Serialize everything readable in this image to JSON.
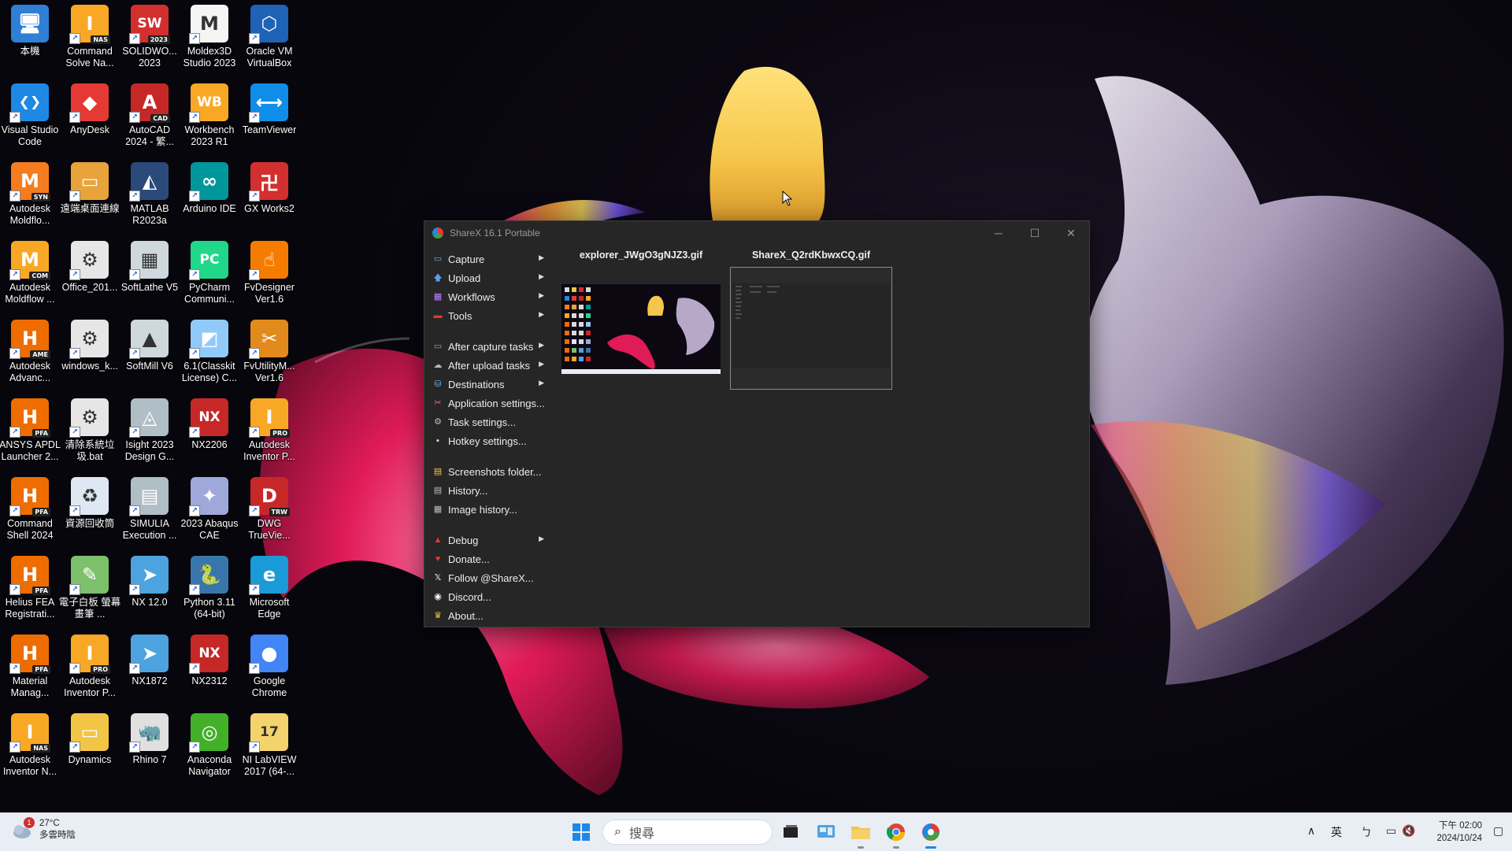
{
  "desktop": {
    "columns": [
      [
        {
          "label": "本機",
          "icon": "computer-icon",
          "color": "#2f7fd6",
          "glyph": "🖥"
        },
        {
          "label": "Visual Studio Code",
          "icon": "vscode-icon",
          "color": "#1e88e5",
          "glyph": "❮❯"
        },
        {
          "label": "Autodesk Moldflo...",
          "icon": "autodesk-moldflow-syn-icon",
          "color": "#f57c1f",
          "glyph": "M",
          "sub": "SYN"
        },
        {
          "label": "Autodesk Moldflow ...",
          "icon": "autodesk-moldflow-com-icon",
          "color": "#f9a825",
          "glyph": "M",
          "sub": "COM"
        },
        {
          "label": "Autodesk Advanc...",
          "icon": "autodesk-advance-icon",
          "color": "#ef6c00",
          "glyph": "H",
          "sub": "AME"
        },
        {
          "label": "ANSYS APDL Launcher 2...",
          "icon": "ansys-apdl-icon",
          "color": "#ef6c00",
          "glyph": "H",
          "sub": "PFA"
        },
        {
          "label": "Command Shell 2024",
          "icon": "command-shell-icon",
          "color": "#ef6c00",
          "glyph": "H",
          "sub": "PFA"
        },
        {
          "label": "Helius FEA Registrati...",
          "icon": "helius-fea-icon",
          "color": "#ef6c00",
          "glyph": "H",
          "sub": "PFA"
        },
        {
          "label": "Material Manag...",
          "icon": "material-manager-icon",
          "color": "#ef6c00",
          "glyph": "H",
          "sub": "PFA"
        },
        {
          "label": "Autodesk Inventor N...",
          "icon": "autodesk-inventor-nas-icon",
          "color": "#f9a825",
          "glyph": "I",
          "sub": "NAS"
        }
      ],
      [
        {
          "label": "Command Solve Na...",
          "icon": "command-solve-nas-icon",
          "color": "#f9a825",
          "glyph": "I",
          "sub": "NAS"
        },
        {
          "label": "AnyDesk",
          "icon": "anydesk-icon",
          "color": "#e53935",
          "glyph": "◆"
        },
        {
          "label": "遠端桌面連線",
          "icon": "remote-desktop-folder-icon",
          "color": "#e8a33a",
          "glyph": "▭"
        },
        {
          "label": "Office_201...",
          "icon": "office-settings-icon",
          "color": "#e6e6e6",
          "glyph": "⚙"
        },
        {
          "label": "windows_k...",
          "icon": "windows-k-settings-icon",
          "color": "#e6e6e6",
          "glyph": "⚙"
        },
        {
          "label": "清除系統垃圾.bat",
          "icon": "batch-file-icon",
          "color": "#e6e6e6",
          "glyph": "⚙"
        },
        {
          "label": "資源回收筒",
          "icon": "recycle-bin-icon",
          "color": "#dfe8f2",
          "glyph": "♻"
        },
        {
          "label": "電子白板 螢幕畫筆 ...",
          "icon": "whiteboard-icon",
          "color": "#7cc06b",
          "glyph": "✎"
        },
        {
          "label": "Autodesk Inventor P...",
          "icon": "autodesk-inventor-pro-icon",
          "color": "#f9a825",
          "glyph": "I",
          "sub": "PRO"
        },
        {
          "label": "Dynamics",
          "icon": "dynamics-folder-icon",
          "color": "#f3c544",
          "glyph": "▭"
        }
      ],
      [
        {
          "label": "SOLIDWO... 2023",
          "icon": "solidworks-icon",
          "color": "#d32f2f",
          "glyph": "SW",
          "sub": "2023"
        },
        {
          "label": "AutoCAD 2024 - 繁...",
          "icon": "autocad-icon",
          "color": "#c62828",
          "glyph": "A",
          "sub": "CAD"
        },
        {
          "label": "MATLAB R2023a",
          "icon": "matlab-icon",
          "color": "#2b4a7a",
          "glyph": "◭"
        },
        {
          "label": "SoftLathe V5",
          "icon": "softlathe-icon",
          "color": "#cfd8dc",
          "glyph": "▦"
        },
        {
          "label": "SoftMill V6",
          "icon": "softmill-icon",
          "color": "#cfd8dc",
          "glyph": "▲"
        },
        {
          "label": "Isight 2023 Design G...",
          "icon": "isight-icon",
          "color": "#b0bec5",
          "glyph": "◬"
        },
        {
          "label": "SIMULIA Execution ...",
          "icon": "simulia-icon",
          "color": "#b0bec5",
          "glyph": "▤"
        },
        {
          "label": "NX 12.0",
          "icon": "nx12-icon",
          "color": "#4da3e0",
          "glyph": "➤"
        },
        {
          "label": "NX1872",
          "icon": "nx1872-icon",
          "color": "#4da3e0",
          "glyph": "➤"
        },
        {
          "label": "Rhino 7",
          "icon": "rhino-icon",
          "color": "#e0e0e0",
          "glyph": "🦏"
        }
      ],
      [
        {
          "label": "Moldex3D Studio 2023",
          "icon": "moldex3d-icon",
          "color": "#f5f5f5",
          "glyph": "M"
        },
        {
          "label": "Workbench 2023 R1",
          "icon": "workbench-icon",
          "color": "#f9a825",
          "glyph": "WB"
        },
        {
          "label": "Arduino IDE",
          "icon": "arduino-icon",
          "color": "#00979c",
          "glyph": "∞"
        },
        {
          "label": "PyCharm Communi...",
          "icon": "pycharm-icon",
          "color": "#21d789",
          "glyph": "PC"
        },
        {
          "label": "6.1(Classkit License) C...",
          "icon": "classkit-icon",
          "color": "#90caf9",
          "glyph": "◩"
        },
        {
          "label": "NX2206",
          "icon": "nx2206-icon",
          "color": "#c62828",
          "glyph": "NX"
        },
        {
          "label": "2023 Abaqus CAE",
          "icon": "abaqus-icon",
          "color": "#9fa8da",
          "glyph": "✦"
        },
        {
          "label": "Python 3.11 (64-bit)",
          "icon": "python-icon",
          "color": "#3776ab",
          "glyph": "🐍"
        },
        {
          "label": "NX2312",
          "icon": "nx2312-icon",
          "color": "#c62828",
          "glyph": "NX"
        },
        {
          "label": "Anaconda Navigator",
          "icon": "anaconda-icon",
          "color": "#43b02a",
          "glyph": "◎"
        }
      ],
      [
        {
          "label": "Oracle VM VirtualBox",
          "icon": "virtualbox-icon",
          "color": "#1e63b5",
          "glyph": "⬡"
        },
        {
          "label": "TeamViewer",
          "icon": "teamviewer-icon",
          "color": "#0e8ee9",
          "glyph": "⟷"
        },
        {
          "label": "GX Works2",
          "icon": "gx-works2-icon",
          "color": "#d32f2f",
          "glyph": "卍"
        },
        {
          "label": "FvDesigner Ver1.6",
          "icon": "fvdesigner-icon",
          "color": "#f57c00",
          "glyph": "☝"
        },
        {
          "label": "FvUtilityM... Ver1.6",
          "icon": "fvutility-icon",
          "color": "#e38a1c",
          "glyph": "✂"
        },
        {
          "label": "Autodesk Inventor P...",
          "icon": "autodesk-inventor-pro-icon",
          "color": "#f9a825",
          "glyph": "I",
          "sub": "PRO"
        },
        {
          "label": "DWG TrueVie...",
          "icon": "dwg-trueview-icon",
          "color": "#c62828",
          "glyph": "D",
          "sub": "TRW"
        },
        {
          "label": "Microsoft Edge",
          "icon": "edge-icon",
          "color": "#1a9ad6",
          "glyph": "e"
        },
        {
          "label": "Google Chrome",
          "icon": "chrome-icon",
          "color": "#4285f4",
          "glyph": "●"
        },
        {
          "label": "NI LabVIEW 2017 (64-...",
          "icon": "labview-icon",
          "color": "#f3d36b",
          "glyph": "17"
        }
      ]
    ]
  },
  "sharex": {
    "title": "ShareX 16.1 Portable",
    "controls": {
      "minimize": "─",
      "maximize": "☐",
      "close": "✕"
    },
    "menu": [
      {
        "label": "Capture",
        "icon": "capture-icon",
        "glyph": "▭",
        "color": "#6fa8dc",
        "submenu": true
      },
      {
        "label": "Upload",
        "icon": "upload-icon",
        "glyph": "🡅",
        "color": "#5c9ded",
        "submenu": true
      },
      {
        "label": "Workflows",
        "icon": "workflows-icon",
        "glyph": "▦",
        "color": "#c77dff",
        "submenu": true
      },
      {
        "label": "Tools",
        "icon": "tools-icon",
        "glyph": "▬",
        "color": "#e53935",
        "submenu": true
      },
      {
        "sep": true
      },
      {
        "label": "After capture tasks",
        "icon": "after-capture-icon",
        "glyph": "▭",
        "color": "#90a4ae",
        "submenu": true
      },
      {
        "label": "After upload tasks",
        "icon": "after-upload-icon",
        "glyph": "☁",
        "color": "#b0bec5",
        "submenu": true
      },
      {
        "label": "Destinations",
        "icon": "destinations-icon",
        "glyph": "⛁",
        "color": "#64b5f6",
        "submenu": true
      },
      {
        "label": "Application settings...",
        "icon": "application-settings-icon",
        "glyph": "✂",
        "color": "#e57373",
        "submenu": false
      },
      {
        "label": "Task settings...",
        "icon": "task-settings-icon",
        "glyph": "⚙",
        "color": "#bdbdbd",
        "submenu": false
      },
      {
        "label": "Hotkey settings...",
        "icon": "hotkey-settings-icon",
        "glyph": "▪",
        "color": "#e0e0e0",
        "submenu": false
      },
      {
        "sep": true
      },
      {
        "label": "Screenshots folder...",
        "icon": "screenshots-folder-icon",
        "glyph": "▤",
        "color": "#f3c544",
        "submenu": false
      },
      {
        "label": "History...",
        "icon": "history-icon",
        "glyph": "▤",
        "color": "#bdbdbd",
        "submenu": false
      },
      {
        "label": "Image history...",
        "icon": "image-history-icon",
        "glyph": "▦",
        "color": "#bdbdbd",
        "submenu": false
      },
      {
        "sep": true
      },
      {
        "label": "Debug",
        "icon": "debug-icon",
        "glyph": "▲",
        "color": "#e53935",
        "submenu": true
      },
      {
        "label": "Donate...",
        "icon": "donate-heart-icon",
        "glyph": "♥",
        "color": "#e53935",
        "submenu": false
      },
      {
        "label": "Follow @ShareX...",
        "icon": "x-logo-icon",
        "glyph": "𝕏",
        "color": "#ffffff",
        "submenu": false
      },
      {
        "label": "Discord...",
        "icon": "discord-icon",
        "glyph": "◉",
        "color": "#ffffff",
        "submenu": false
      },
      {
        "label": "About...",
        "icon": "about-crown-icon",
        "glyph": "♛",
        "color": "#f3c544",
        "submenu": false
      }
    ],
    "files": [
      {
        "name": "explorer_JWgO3gNJZ3.gif"
      },
      {
        "name": "ShareX_Q2rdKbwxCQ.gif"
      }
    ]
  },
  "taskbar": {
    "weather": {
      "temp": "27°C",
      "desc": "多雲時陰",
      "badge": "1"
    },
    "search_placeholder": "搜尋",
    "tray": {
      "ime": "英",
      "ime2": "ㄅ",
      "time": "下午 02:00",
      "date": "2024/10/24"
    }
  }
}
